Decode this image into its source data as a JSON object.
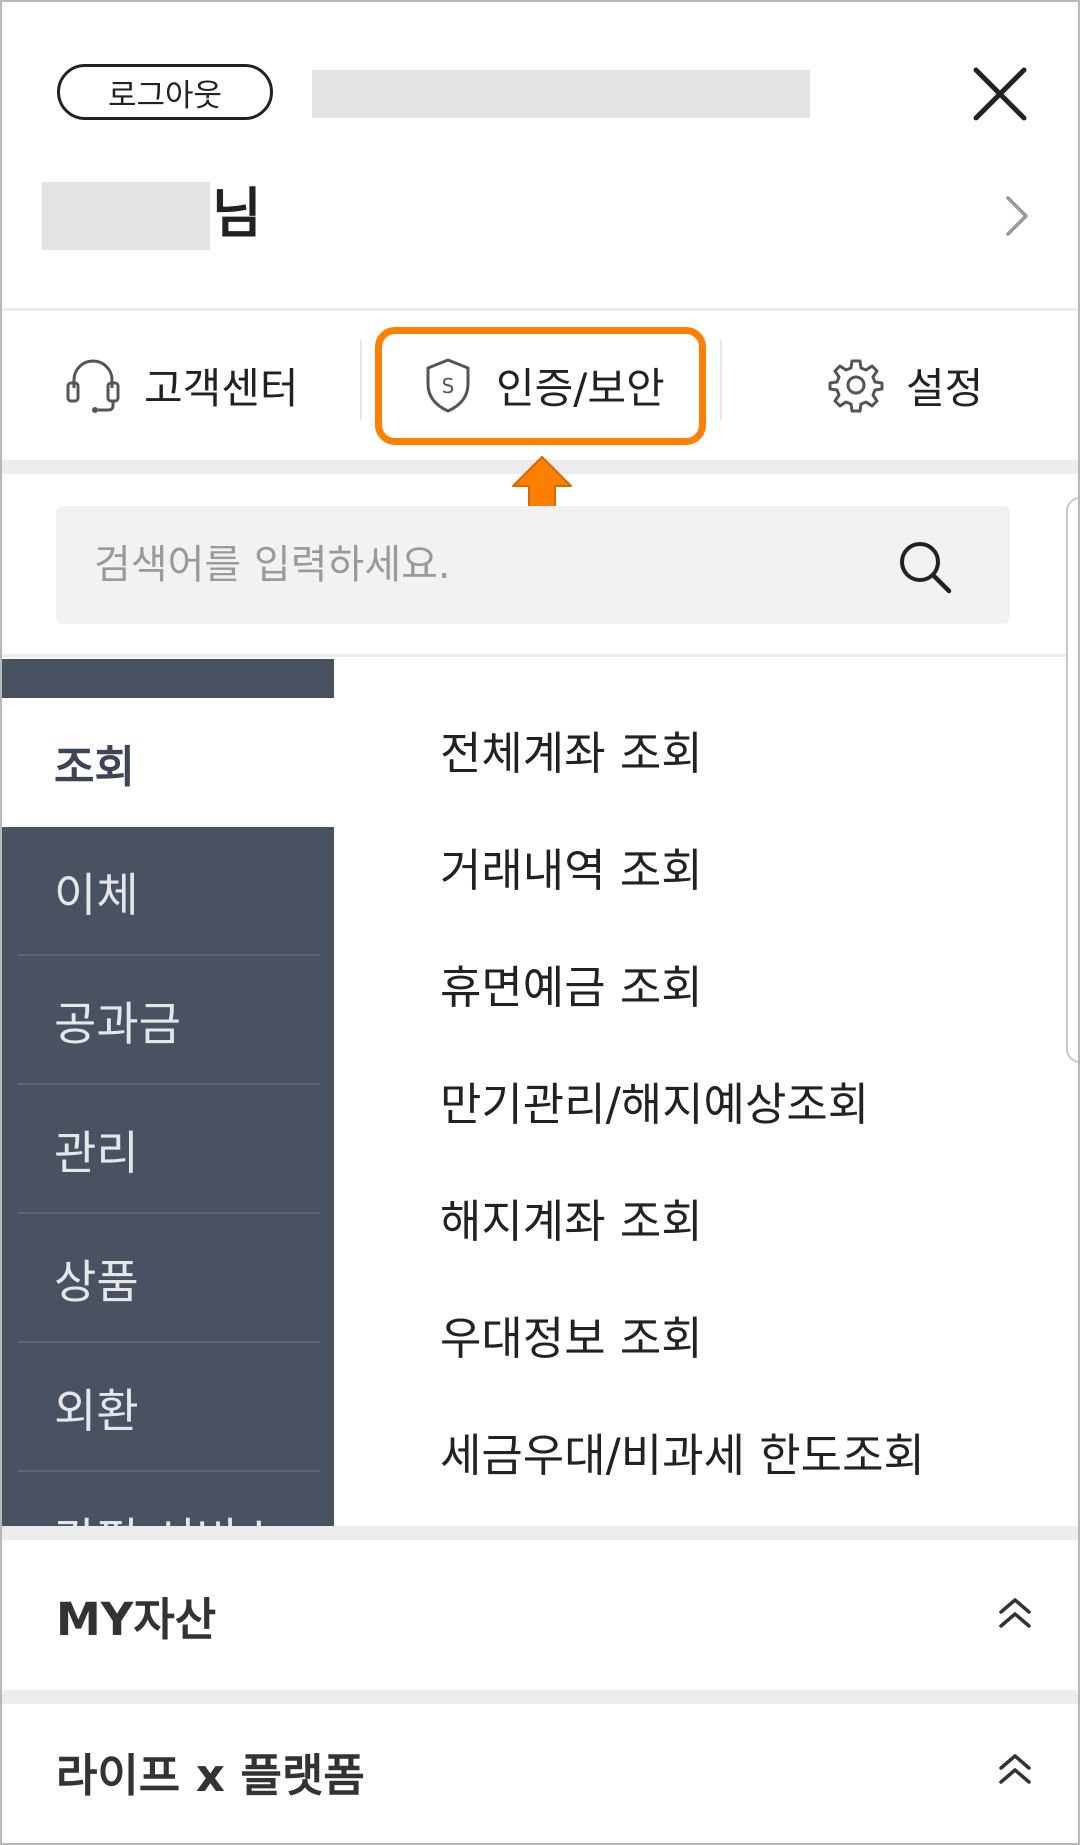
{
  "header": {
    "logout_label": "로그아웃",
    "name_suffix": "님"
  },
  "quick_menu": {
    "customer_center": "고객센터",
    "auth_security": "인증/보안",
    "settings": "설정"
  },
  "search": {
    "placeholder": "검색어를 입력하세요."
  },
  "categories": [
    "조회",
    "이체",
    "공과금",
    "관리",
    "상품",
    "외환",
    "간편 서비스"
  ],
  "active_category": "조회",
  "submenu": [
    "전체계좌 조회",
    "거래내역 조회",
    "휴면예금 조회",
    "만기관리/해지예상조회",
    "해지계좌 조회",
    "우대정보 조회",
    "세금우대/비과세 한도조회"
  ],
  "sections": [
    {
      "title": "MY자산"
    },
    {
      "title": "라이프 x 플랫폼"
    }
  ],
  "colors": {
    "highlight": "#ff7f00",
    "sidebar_bg": "#485260"
  }
}
